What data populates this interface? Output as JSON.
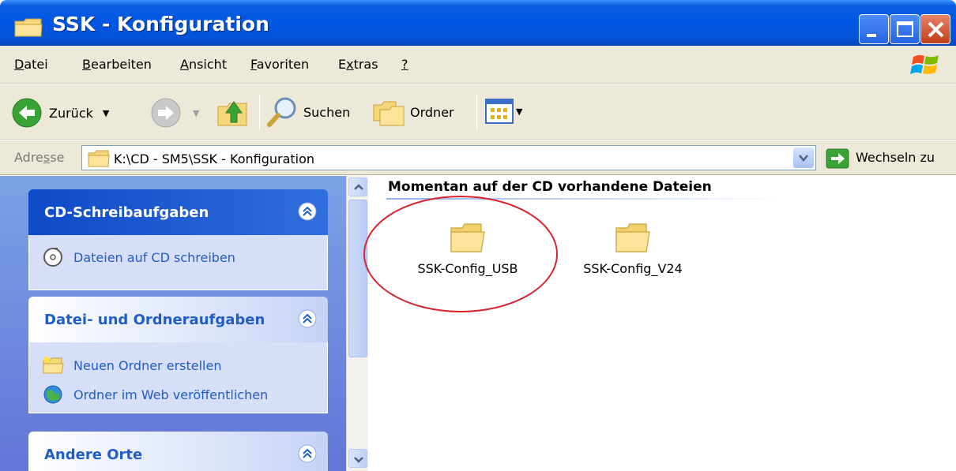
{
  "window": {
    "title": "SSK - Konfiguration"
  },
  "menu": {
    "items": [
      {
        "pre": "",
        "u": "D",
        "post": "atei"
      },
      {
        "pre": "",
        "u": "B",
        "post": "earbeiten"
      },
      {
        "pre": "",
        "u": "A",
        "post": "nsicht"
      },
      {
        "pre": "",
        "u": "F",
        "post": "avoriten"
      },
      {
        "pre": "E",
        "u": "x",
        "post": "tras"
      },
      {
        "pre": "",
        "u": "?",
        "post": ""
      }
    ]
  },
  "toolbar": {
    "back_label": "Zurück",
    "search_label": "Suchen",
    "folders_label": "Ordner"
  },
  "address": {
    "label_pre": "Adre",
    "label_u": "s",
    "label_post": "se",
    "path": "K:\\CD - SM5\\SSK - Konfiguration",
    "go_label": "Wechseln zu"
  },
  "taskpane": {
    "groups": [
      {
        "title": "CD-Schreibaufgaben",
        "tasks": [
          "Dateien auf CD schreiben"
        ]
      },
      {
        "title": "Datei- und Ordneraufgaben",
        "tasks": [
          "Neuen Ordner erstellen",
          "Ordner im Web veröffentlichen"
        ]
      },
      {
        "title": "Andere Orte",
        "tasks": []
      }
    ]
  },
  "content": {
    "section_title": "Momentan auf der CD vorhandene Dateien",
    "files": [
      {
        "name": "SSK-Config_USB",
        "icon": "folder-icon",
        "highlighted": true
      },
      {
        "name": "SSK-Config_V24",
        "icon": "folder-icon",
        "highlighted": false
      }
    ]
  },
  "colors": {
    "titlebar": "#0055e5",
    "menu_bg": "#ece9d8",
    "taskpane_bg": "#7ba2e7",
    "task_link": "#215dc6",
    "highlight_ring": "#d9232e"
  }
}
